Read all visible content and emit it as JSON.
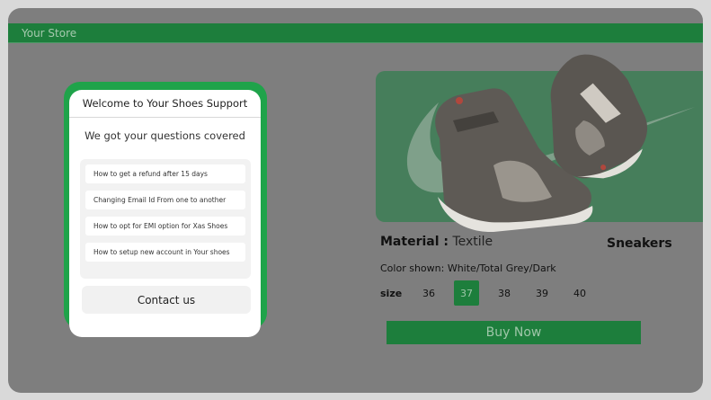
{
  "store": {
    "name": "Your Store",
    "brand_color": "#1d7e3c"
  },
  "product": {
    "material_label": "Material :",
    "material_value": "Textile",
    "category": "Sneakers",
    "color_label": "Color shown:",
    "color_value": "White/Total Grey/Dark",
    "size_label": "size",
    "sizes": [
      "36",
      "37",
      "38",
      "39",
      "40"
    ],
    "selected_size": "37",
    "buy_label": "Buy Now",
    "image_icon": "sneaker-image"
  },
  "support": {
    "title": "Welcome to Your Shoes Support",
    "subtitle": "We got your questions covered",
    "faqs": [
      "How to get a refund after 15 days",
      "Changing Email Id From one to another",
      "How to opt for EMI option for Xas Shoes",
      "How to setup new account in Your shoes"
    ],
    "contact_label": "Contact us",
    "accent_color": "#1fa34a"
  }
}
